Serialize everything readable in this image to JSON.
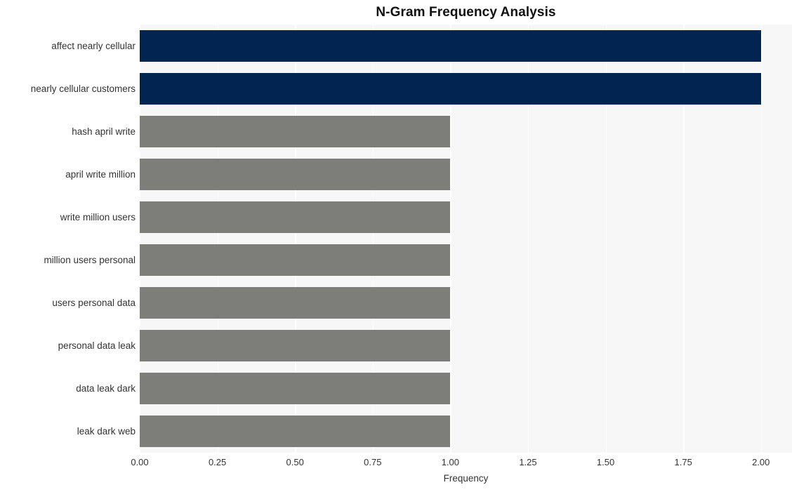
{
  "chart_data": {
    "type": "bar",
    "orientation": "horizontal",
    "title": "N-Gram Frequency Analysis",
    "xlabel": "Frequency",
    "ylabel": "",
    "categories": [
      "affect nearly cellular",
      "nearly cellular customers",
      "hash april write",
      "april write million",
      "write million users",
      "million users personal",
      "users personal data",
      "personal data leak",
      "data leak dark",
      "leak dark web"
    ],
    "values": [
      2,
      2,
      1,
      1,
      1,
      1,
      1,
      1,
      1,
      1
    ],
    "bar_colors": [
      "#022450",
      "#022450",
      "#7d7d7a",
      "#7d7d7a",
      "#7d7d7a",
      "#7d7d7a",
      "#7d7d7a",
      "#7d7d7a",
      "#7d7d7a",
      "#7d7d7a"
    ],
    "xlim": [
      0,
      2.1
    ],
    "xticks": [
      0,
      0.25,
      0.5,
      0.75,
      1,
      1.25,
      1.5,
      1.75,
      2
    ],
    "xtick_labels": [
      "0.00",
      "0.25",
      "0.50",
      "0.75",
      "1.00",
      "1.25",
      "1.50",
      "1.75",
      "2.00"
    ],
    "grid": true,
    "grid_axis": "x",
    "grid_color": "#ffffff",
    "plot_background": "#f7f7f7",
    "figure_background": "#ffffff",
    "legend": null,
    "highlight_color": "#022450",
    "default_color": "#7d7d7a"
  }
}
